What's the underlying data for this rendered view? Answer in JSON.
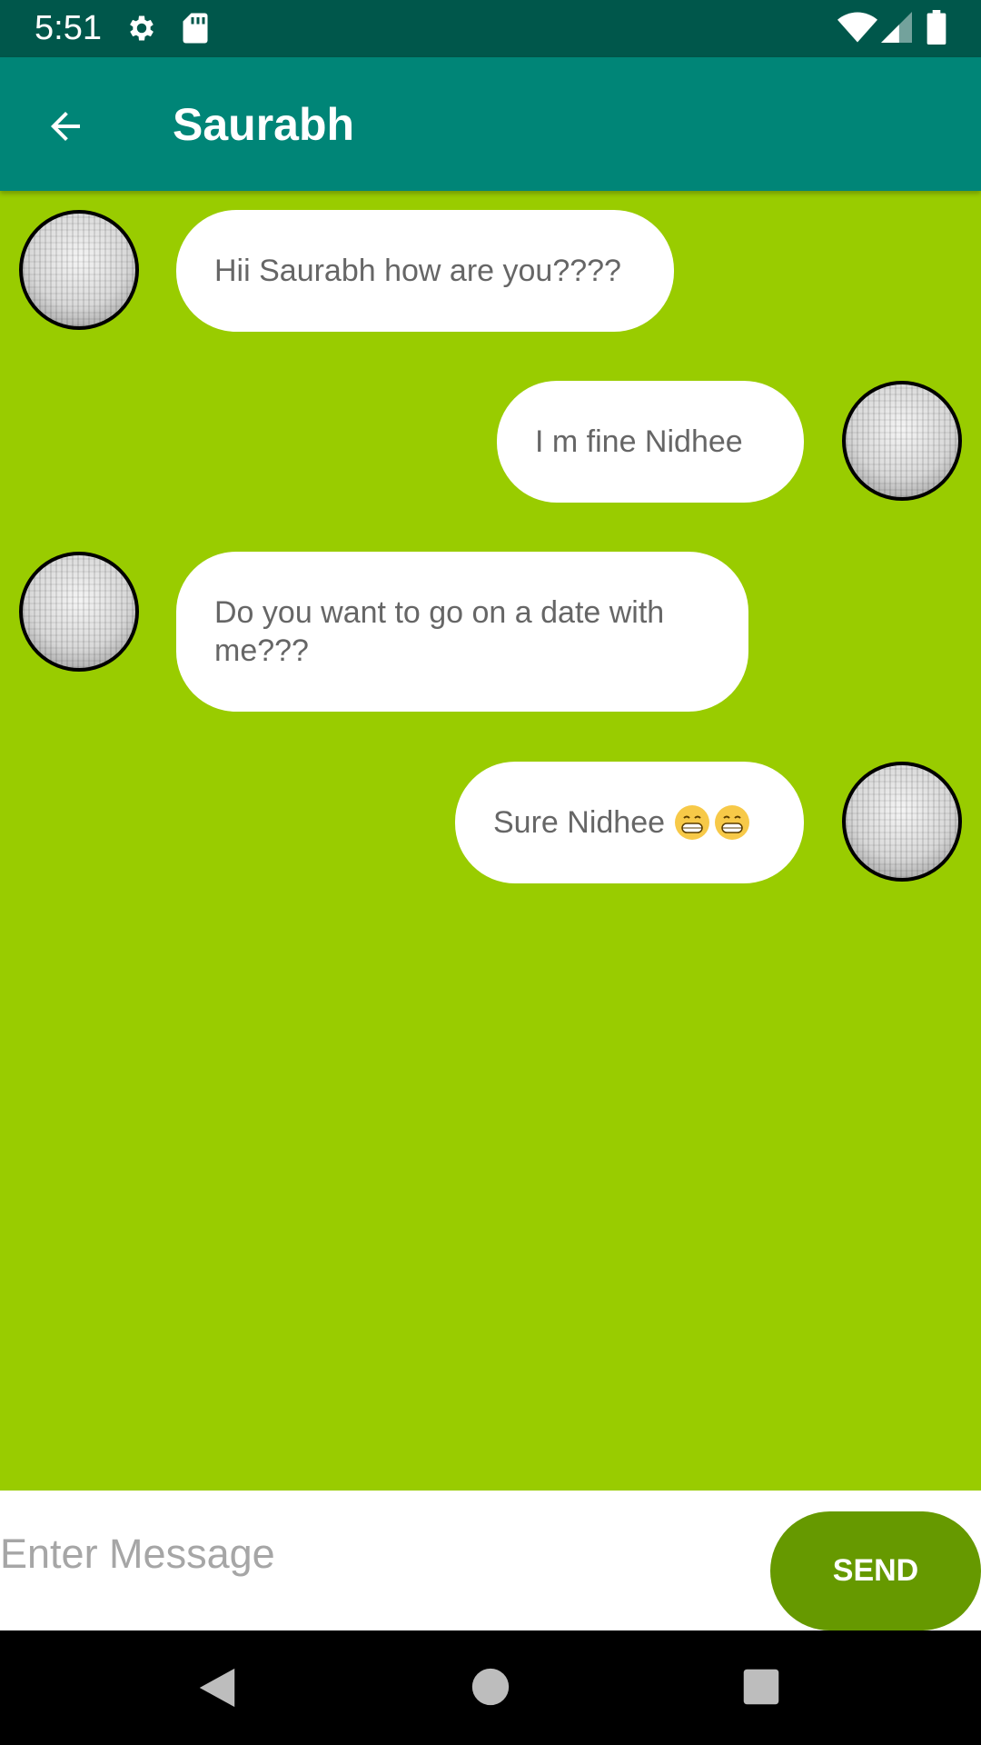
{
  "status_bar": {
    "time": "5:51",
    "icons": [
      "gear-icon",
      "sd-card-icon",
      "wifi-icon",
      "signal-icon",
      "battery-icon"
    ]
  },
  "app_bar": {
    "title": "Saurabh",
    "back_icon": "arrow-left-icon"
  },
  "messages": [
    {
      "side": "left",
      "text": "Hii Saurabh how are you????"
    },
    {
      "side": "right",
      "text": "I m fine Nidhee"
    },
    {
      "side": "left",
      "text": "Do you want to go on a date with me???"
    },
    {
      "side": "right",
      "text": "Sure Nidhee",
      "emoji": [
        "grinning-face-emoji",
        "grinning-face-emoji"
      ]
    }
  ],
  "composer": {
    "placeholder": "Enter Message",
    "value": "",
    "send_label": "SEND"
  },
  "nav_bar": {
    "icons": [
      "nav-back-icon",
      "nav-home-icon",
      "nav-recents-icon"
    ]
  },
  "colors": {
    "status_bar": "#00574b",
    "app_bar": "#008577",
    "chat_background": "#99cc00",
    "send_button": "#669900",
    "bubble": "#ffffff",
    "bubble_text": "#666666"
  }
}
